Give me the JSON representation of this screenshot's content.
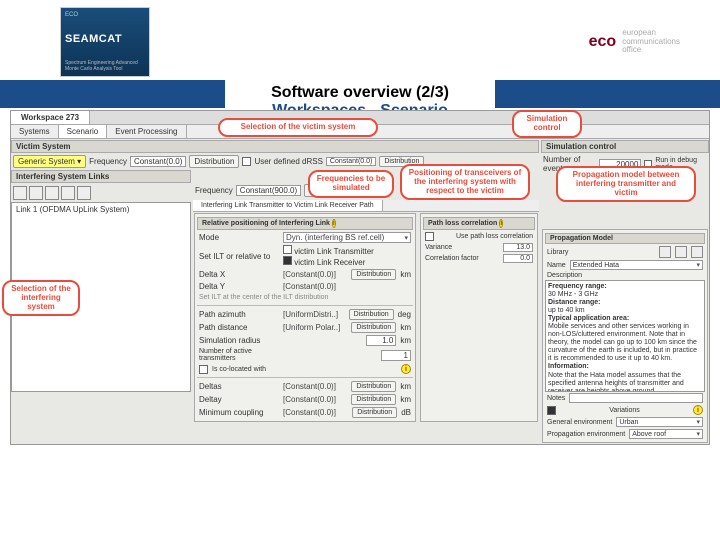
{
  "header": {
    "logo_top": "ECO",
    "logo_main": "SEAMCAT",
    "logo_sub": "Spectrum Engineering Advanced Monte Carlo Analysis Tool",
    "org_logo": "eco",
    "org_sub1": "european",
    "org_sub2": "communications",
    "org_sub3": "office"
  },
  "title": {
    "line1": "Software overview (2/3)",
    "line2": "Workspaces - Scenario"
  },
  "tabs": {
    "ws": "Workspace 273"
  },
  "toolTabs": {
    "a": "Systems",
    "b": "Scenario",
    "c": "Event Processing"
  },
  "callouts": {
    "c1": "Selection of the victim system",
    "c2": "Simulation control",
    "c3": "Frequencies to be simulated",
    "c4": "Positioning of transceivers of the interfering system with respect to the victim",
    "c5": "Propagation model between interfering transmitter and victim",
    "c6": "Selection of the interfering system"
  },
  "vs": {
    "header": "Victim System",
    "btn": "Generic System",
    "freqLab": "Frequency",
    "freqVal": "Constant(0.0)",
    "distr": "Distribution",
    "udrss": "User defined dRSS",
    "udrssVal": "Constant(0.0)"
  },
  "sim": {
    "header": "Simulation control",
    "evLab": "Number of events",
    "evVal": "20000",
    "debug": "Run in debug mode"
  },
  "isl": {
    "header": "Interfering System Links",
    "item": "Link 1 (OFDMA UpLink System)"
  },
  "rlink": {
    "freqLab": "Frequency",
    "freqVal": "Constant(900.0)",
    "distr": "Distribution"
  },
  "pathTab": "Interfering Link Transmitter to Victim Link Receiver Path",
  "relpos": {
    "header": "Relative positioning of Interfering Link",
    "mode": "Mode",
    "modeVal": "Dyn. (interfering BS ref.cell)",
    "setLab": "Set ILT or relative to",
    "optA": "victim Link Transmitter",
    "optB": "victim Link Receiver",
    "dx": "Delta X",
    "dxVal": "[Constant(0.0)]",
    "dxEnd": "Distribution",
    "dxUnit": "km",
    "dy": "Delta Y",
    "dyVal": "[Constant(0.0)]",
    "note": "Set ILT at the center of the ILT distribution",
    "paz": "Path azimuth",
    "pazVal": "[UniformDistri..]",
    "pazEnd": "Distribution",
    "pazU": "deg",
    "pdi": "Path distance",
    "pdiVal": "[Uniform Polar..]",
    "pdiEnd": "Distribution",
    "pdiU": "km",
    "sr": "Simulation radius",
    "srVal": "1.0",
    "srU": "km",
    "nat": "Number of active transmitters",
    "natVal": "1",
    "iw": "Is co-located with",
    "dlt": "Deltas",
    "dltVal": "[Constant(0.0)]",
    "dltEnd": "Distribution",
    "dltU": "km",
    "dlt2": "Deltay",
    "dlt2Val": "[Constant(0.0)]",
    "dlt2End": "Distribution",
    "dlt2U": "km",
    "mc": "Minimum coupling",
    "mcVal": "[Constant(0.0)]",
    "mcEnd": "Distribution",
    "mcU": "dB"
  },
  "plc": {
    "header": "Path loss correlation",
    "use": "Use path loss correlation",
    "var": "Variance",
    "varVal": "13.0",
    "cf": "Correlation factor",
    "cfVal": "0.0"
  },
  "pm": {
    "header": "Propagation Model",
    "lib": "Library",
    "name": "Name",
    "nameVal": "Extended Hata",
    "desc": "Description",
    "d1": "Frequency range:",
    "d2": "30 MHz - 3 GHz",
    "d3": "Distance range:",
    "d4": "up to 40 km",
    "d5": "Typical application area:",
    "d6": "Mobile services and other services working in non-LOS/cluttered environment. Note that in theory, the model can go up to 100 km since the curvature of the earth is included, but in practice it is recommended to use it up to 40 km.",
    "d7": "Information:",
    "d8": "Note that the Hata model assumes that the specified antenna heights of transmitter and receiver are heights above ground.",
    "notes": "Notes",
    "var": "Variations",
    "ge": "General environment",
    "geVal": "Urban",
    "pe": "Propagation environment",
    "peVal": "Above roof"
  }
}
